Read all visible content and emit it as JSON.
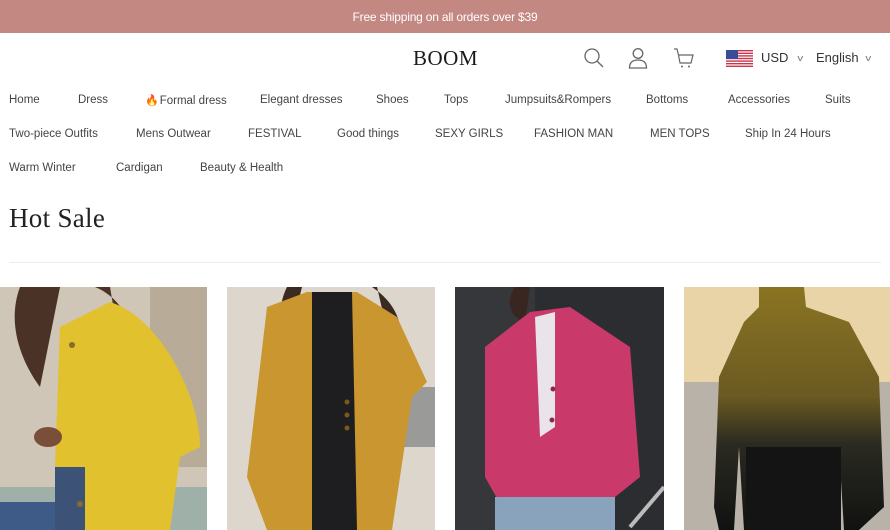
{
  "announcement": {
    "text": "Free shipping on all orders over $39",
    "background": "#c48882"
  },
  "header": {
    "logo": "BOOM",
    "icons": [
      "search-icon",
      "account-icon",
      "cart-icon"
    ],
    "currency": {
      "flag": "us-flag-icon",
      "value": "USD"
    },
    "language": {
      "value": "English"
    }
  },
  "nav": {
    "rows": [
      [
        {
          "label": "Home"
        },
        {
          "label": "Dress"
        },
        {
          "label": "Formal dress",
          "icon": "fire-icon"
        },
        {
          "label": "Elegant dresses"
        },
        {
          "label": "Shoes"
        },
        {
          "label": "Tops"
        },
        {
          "label": "Jumpsuits&Rompers"
        },
        {
          "label": "Bottoms"
        },
        {
          "label": "Accessories"
        },
        {
          "label": "Suits"
        }
      ],
      [
        {
          "label": "Two-piece Outfits"
        },
        {
          "label": "Mens Outwear"
        },
        {
          "label": "FESTIVAL"
        },
        {
          "label": "Good things"
        },
        {
          "label": "SEXY GIRLS"
        },
        {
          "label": "FASHION MAN"
        },
        {
          "label": "MEN TOPS"
        },
        {
          "label": "Ship In 24 Hours"
        }
      ],
      [
        {
          "label": "Warm Winter"
        },
        {
          "label": "Cardigan"
        },
        {
          "label": "Beauty & Health"
        }
      ]
    ]
  },
  "section": {
    "title": "Hot Sale"
  },
  "products": [
    {
      "image": "yellow-stand-collar-blazer-photo",
      "color": "#e2c12e"
    },
    {
      "image": "mustard-lapel-long-coat-photo",
      "color": "#c9962f"
    },
    {
      "image": "fuchsia-blazer-striped-shirt-photo",
      "color": "#c93a6a"
    },
    {
      "image": "gold-metallic-turtleneck-photo",
      "color": "#8a7422"
    }
  ]
}
